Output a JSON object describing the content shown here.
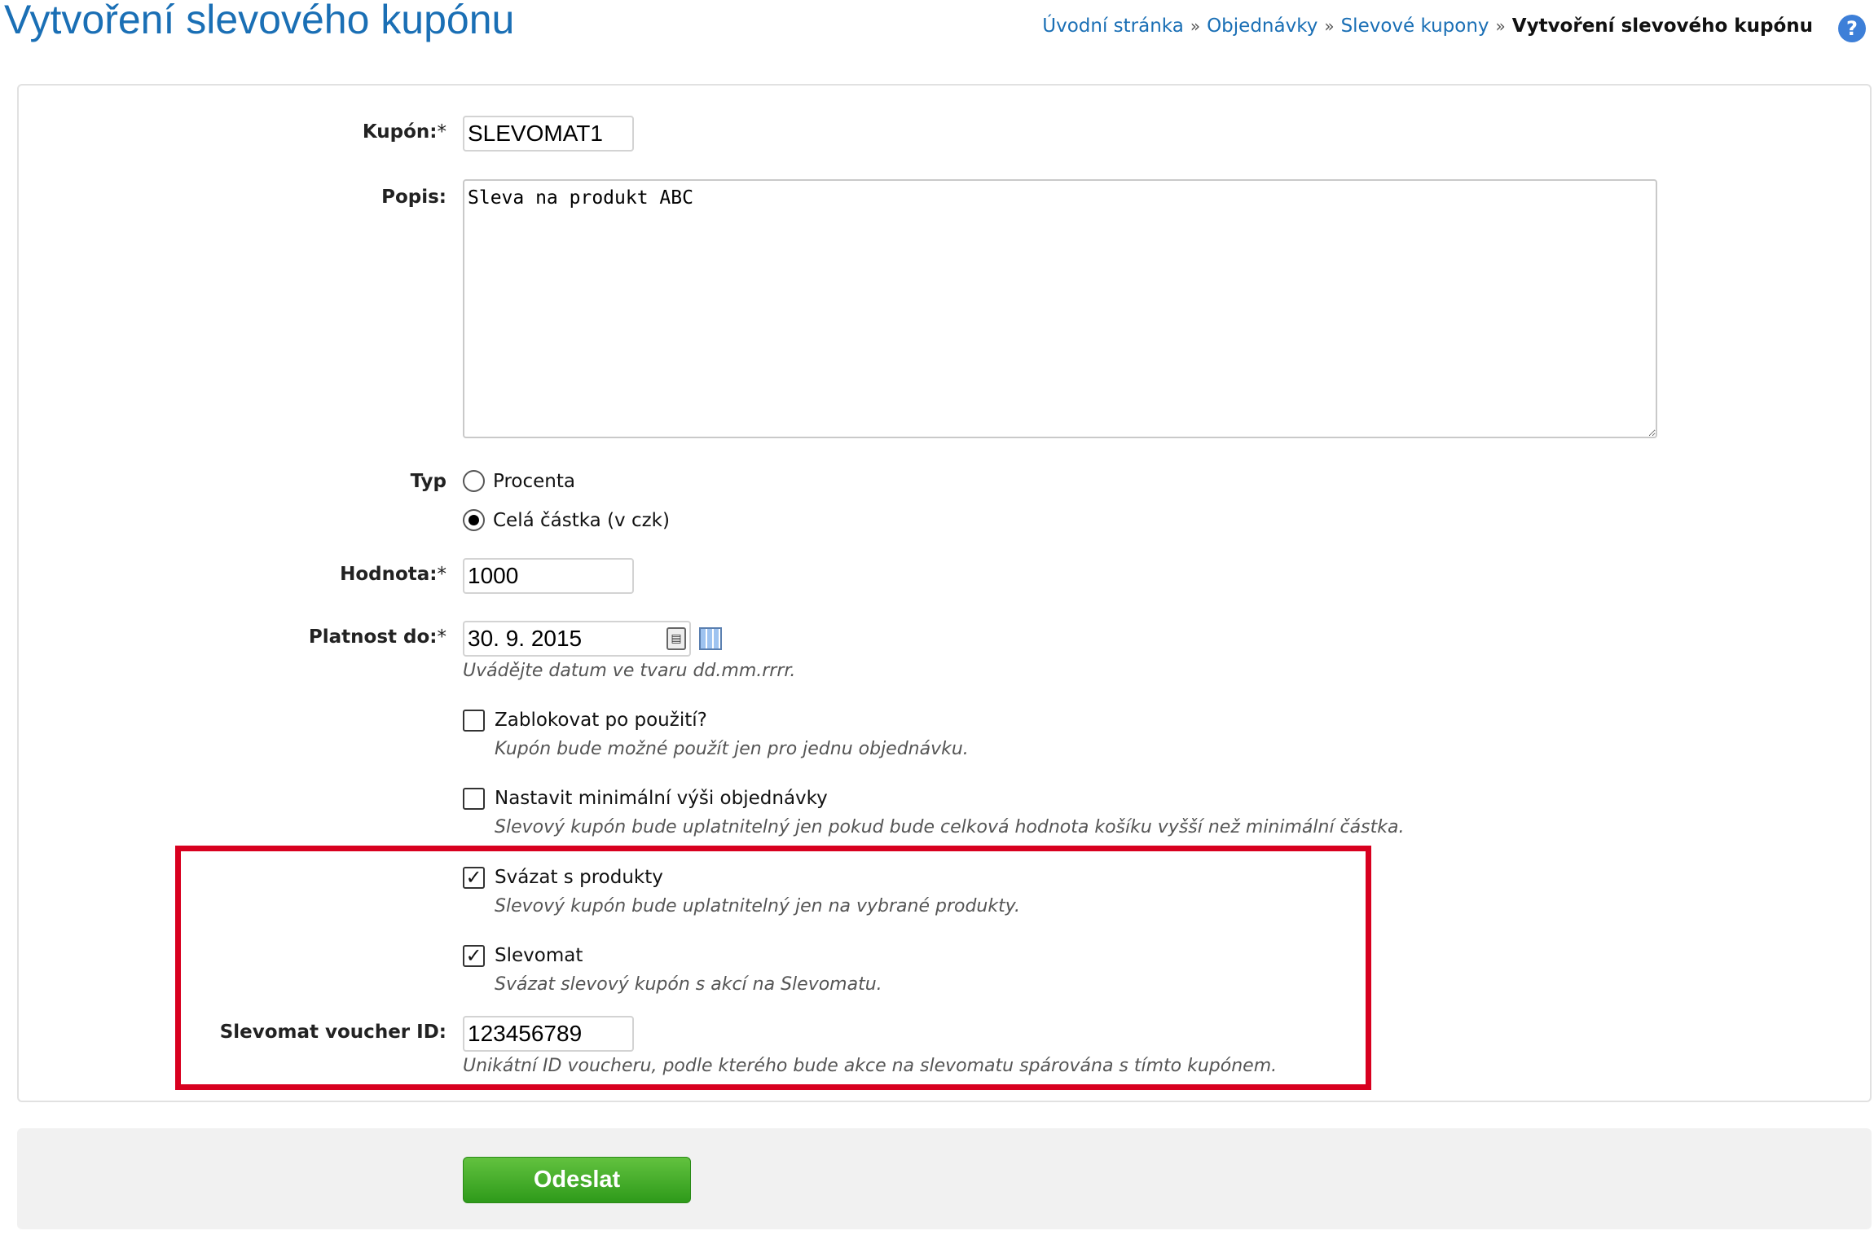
{
  "page": {
    "title": "Vytvoření slevového kupónu",
    "help_icon": "?"
  },
  "breadcrumb": {
    "items": [
      "Úvodní stránka",
      "Objednávky",
      "Slevové kupony"
    ],
    "separator": "»",
    "current": "Vytvoření slevového kupónu"
  },
  "form": {
    "coupon": {
      "label": "Kupón:",
      "required": "*",
      "value": "SLEVOMAT1"
    },
    "description": {
      "label": "Popis:",
      "value": "Sleva na produkt ABC"
    },
    "type": {
      "label": "Typ",
      "options": [
        {
          "label": "Procenta",
          "selected": false
        },
        {
          "label": "Celá částka (v czk)",
          "selected": true
        }
      ]
    },
    "value": {
      "label": "Hodnota:",
      "required": "*",
      "value": "1000"
    },
    "valid_until": {
      "label": "Platnost do:",
      "required": "*",
      "value": "30. 9. 2015",
      "hint": "Uvádějte datum ve tvaru dd.mm.rrrr."
    },
    "block_after_use": {
      "label": "Zablokovat po použití?",
      "checked": false,
      "hint": "Kupón bude možné použít jen pro jednu objednávku."
    },
    "min_order": {
      "label": "Nastavit minimální výši objednávky",
      "checked": false,
      "hint": "Slevový kupón bude uplatnitelný jen pokud bude celková hodnota košíku vyšší než minimální částka."
    },
    "link_products": {
      "label": "Svázat s produkty",
      "checked": true,
      "hint": "Slevový kupón bude uplatnitelný jen na vybrané produkty."
    },
    "slevomat": {
      "label": "Slevomat",
      "checked": true,
      "hint": "Svázat slevový kupón s akcí na Slevomatu."
    },
    "voucher_id": {
      "label": "Slevomat voucher ID:",
      "value": "123456789",
      "hint": "Unikátní ID voucheru, podle kterého bude akce na slevomatu spárována s tímto kupónem."
    }
  },
  "submit": {
    "label": "Odeslat"
  },
  "colors": {
    "accent": "#1a6fb5",
    "highlight": "#d8001f",
    "button": "#2e9a1a"
  }
}
